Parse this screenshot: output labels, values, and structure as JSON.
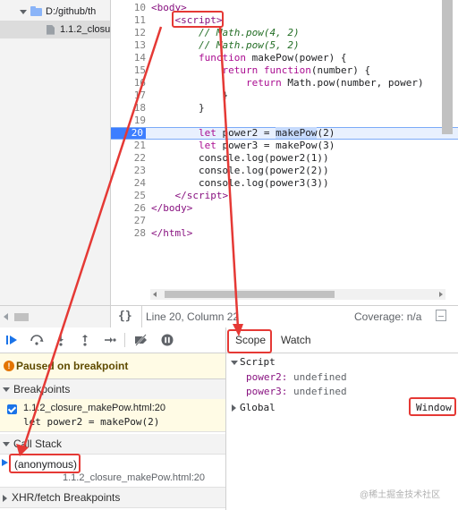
{
  "file_tree": {
    "folder": "D:/github/th",
    "file": "1.1.2_closu"
  },
  "editor": {
    "lines": [
      {
        "n": "10",
        "html": "<span class='tag'>&lt;body&gt;</span>"
      },
      {
        "n": "11",
        "html": "    <span class='tag'>&lt;script&gt;</span>"
      },
      {
        "n": "12",
        "html": "        <span class='cm'>// Math.pow(4, 2)</span>"
      },
      {
        "n": "13",
        "html": "        <span class='cm'>// Math.pow(5, 2)</span>"
      },
      {
        "n": "14",
        "html": "        <span class='kw'>function</span> makePow(power) {"
      },
      {
        "n": "15",
        "html": "            <span class='kw'>return</span> <span class='kw'>function</span>(number) {"
      },
      {
        "n": "16",
        "html": "                <span class='kw'>return</span> Math.pow(number, power)"
      },
      {
        "n": "17",
        "html": "            }"
      },
      {
        "n": "18",
        "html": "        }"
      },
      {
        "n": "19",
        "html": ""
      },
      {
        "n": "20",
        "html": "        <span class='kw'>let</span> power2 = <span class='hl'>makePow</span>(2)",
        "active": true
      },
      {
        "n": "21",
        "html": "        <span class='kw'>let</span> power3 = makePow(3)"
      },
      {
        "n": "22",
        "html": "        console.log(power2(1))"
      },
      {
        "n": "23",
        "html": "        console.log(power2(2))"
      },
      {
        "n": "24",
        "html": "        console.log(power3(3))"
      },
      {
        "n": "25",
        "html": "    <span class='tag'>&lt;/script&gt;</span>"
      },
      {
        "n": "26",
        "html": "<span class='tag'>&lt;/body&gt;</span>"
      },
      {
        "n": "27",
        "html": ""
      },
      {
        "n": "28",
        "html": "<span class='tag'>&lt;/html&gt;</span>"
      }
    ]
  },
  "status": {
    "braces": "{}",
    "position": "Line 20, Column 22",
    "coverage": "Coverage: n/a"
  },
  "debugger": {
    "paused": "Paused on breakpoint",
    "breakpoints_header": "Breakpoints",
    "breakpoint_file": "1.1.2_closure_makePow.html:20",
    "breakpoint_code": "let power2 = makePow(2)",
    "callstack_header": "Call Stack",
    "frame_name": "(anonymous)",
    "frame_location": "1.1.2_closure_makePow.html:20",
    "xhr_header": "XHR/fetch Breakpoints"
  },
  "scope": {
    "tab_scope": "Scope",
    "tab_watch": "Watch",
    "script_label": "Script",
    "vars": [
      {
        "name": "power2",
        "value": "undefined"
      },
      {
        "name": "power3",
        "value": "undefined"
      }
    ],
    "global_label": "Global",
    "global_value": "Window"
  },
  "watermark": "@稀土掘金技术社区",
  "colors": {
    "annotation": "#e53935",
    "active_line": "#3d7eff",
    "paused_bg": "#fffbe5"
  }
}
